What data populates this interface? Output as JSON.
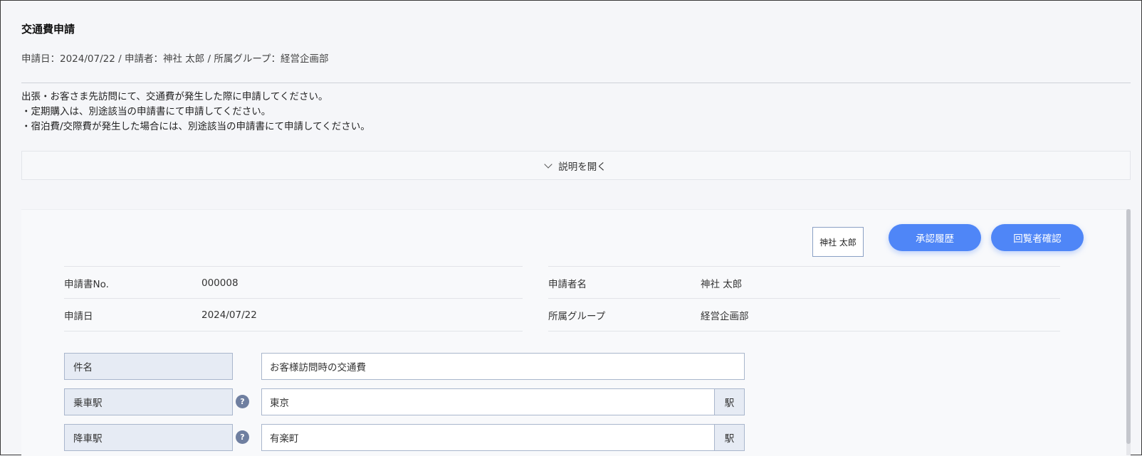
{
  "page": {
    "title": "交通費申請",
    "meta_line": "申請日：2024/07/22 / 申請者：神社 太郎 / 所属グループ：経営企画部",
    "description": [
      "出張・お客さま先訪問にて、交通費が発生した際に申請してください。",
      "・定期購入は、別途該当の申請書にて申請してください。",
      "・宿泊費/交際費が発生した場合には、別途該当の申請書にて申請してください。"
    ],
    "toggle_label": "説明を開く"
  },
  "panel": {
    "approver_stamp": "神社 太郎",
    "buttons": {
      "history": "承認履歴",
      "confirm": "回覧者確認"
    },
    "info": {
      "application_no_label": "申請書No.",
      "application_no_value": "000008",
      "date_label": "申請日",
      "date_value": "2024/07/22",
      "applicant_label": "申請者名",
      "applicant_value": "神社 太郎",
      "group_label": "所属グループ",
      "group_value": "経営企画部"
    },
    "form": {
      "subject_label": "件名",
      "subject_value": "お客様訪問時の交通費",
      "board_label": "乗車駅",
      "board_value": "東京",
      "alight_label": "降車駅",
      "alight_value": "有楽町",
      "station_suffix": "駅",
      "help_glyph": "?"
    }
  },
  "colors": {
    "accent": "#4f86f7",
    "label_bg": "#e6ebf4",
    "border": "#a9b6cc"
  },
  "icons": {
    "toggle": "chevron-down-icon",
    "help": "help-icon"
  }
}
